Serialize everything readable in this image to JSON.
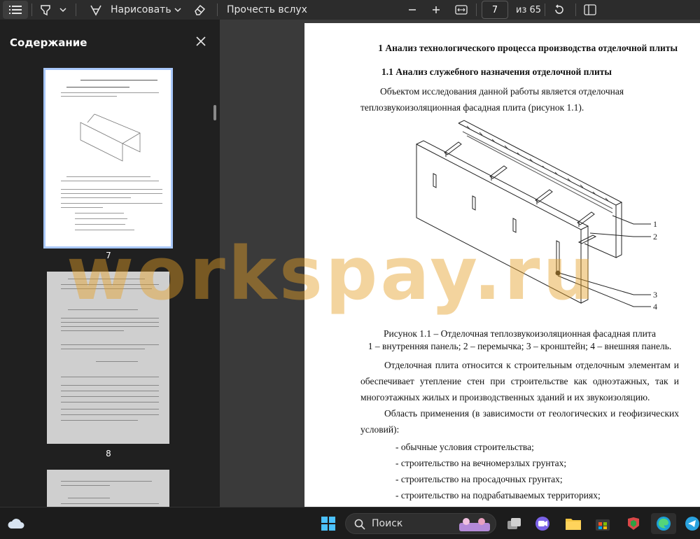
{
  "toolbar": {
    "draw_label": "Нарисовать",
    "read_aloud_label": "Прочесть вслух",
    "current_page": "7",
    "page_total": "из 65"
  },
  "sidebar": {
    "title": "Содержание",
    "thumbnails": [
      {
        "page": "7"
      },
      {
        "page": "8"
      }
    ]
  },
  "document": {
    "heading1": "1 Анализ технологического процесса производства отделочной плиты",
    "heading2": "1.1 Анализ служебного назначения отделочной плиты",
    "intro_line1": "Объектом исследования данной работы является отделочная",
    "intro_line2": "теплозвукоизоляционная фасадная плита (рисунок 1.1).",
    "figure_labels": [
      "1",
      "2",
      "3",
      "4"
    ],
    "caption_line1": "Рисунок 1.1 – Отделочная теплозвукоизоляционная фасадная плита",
    "caption_line2": "1 – внутренняя панель; 2 – перемычка; 3 – кронштейн; 4 – внешняя панель.",
    "para2": "Отделочная плита относится к строительным отделочным элементам и обеспечивает утепление стен при строительстве как одноэтажных, так и многоэтажных жилых и производственных зданий и их звукоизоляцию.",
    "para3": "Область применения (в зависимости от геологических и геофизических условий):",
    "list": [
      "- обычные условия строительства;",
      "- строительство на вечномерзлых грунтах;",
      "- строительство на просадочных грунтах;",
      "- строительство на подрабатываемых территориях;"
    ]
  },
  "watermark": "workspay.ru",
  "taskbar": {
    "search_label": "Поиск"
  },
  "colors": {
    "accent": "#a8c7fa",
    "watermark": "#e4a028"
  }
}
